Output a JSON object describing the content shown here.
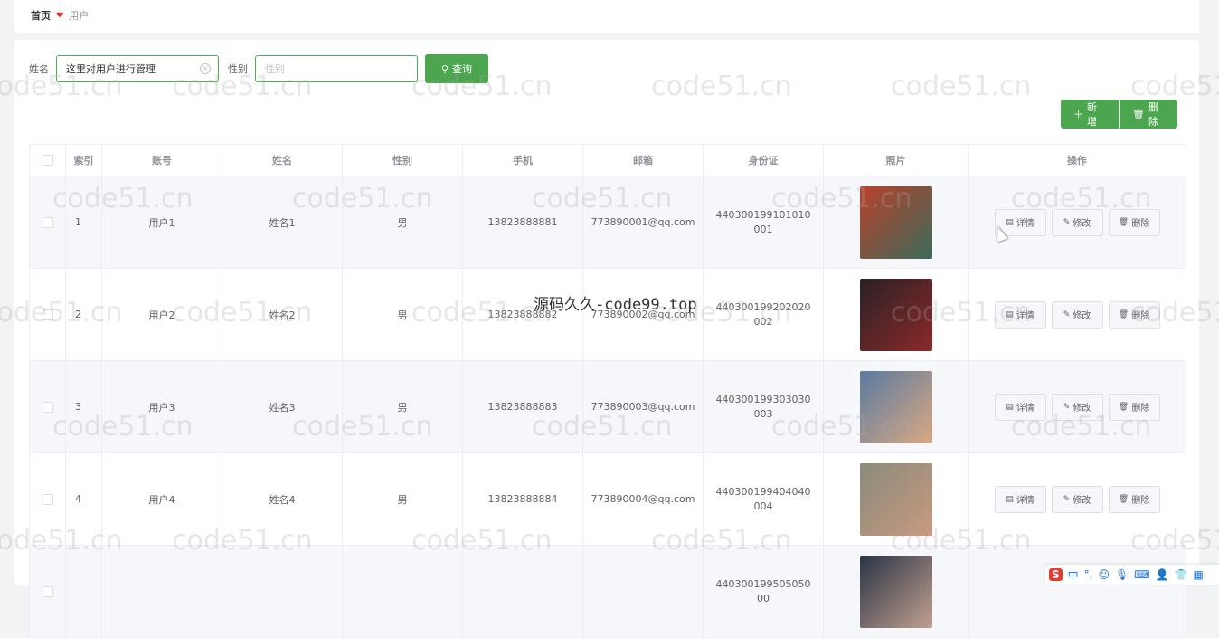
{
  "breadcrumb": {
    "home": "首页",
    "current": "用户"
  },
  "search": {
    "name_label": "姓名",
    "name_value": "这里对用户进行管理",
    "gender_label": "性别",
    "gender_placeholder": "性别",
    "query_label": "查询"
  },
  "actions": {
    "add_label": "新增",
    "delete_label": "删除"
  },
  "table": {
    "headers": [
      "索引",
      "账号",
      "姓名",
      "性别",
      "手机",
      "邮箱",
      "身份证",
      "照片",
      "操作"
    ],
    "rows": [
      {
        "index": "1",
        "account": "用户1",
        "name": "姓名1",
        "gender": "男",
        "phone": "13823888881",
        "email": "773890001@qq.com",
        "idcard": "440300199101010001"
      },
      {
        "index": "2",
        "account": "用户2",
        "name": "姓名2",
        "gender": "男",
        "phone": "13823888882",
        "email": "773890002@qq.com",
        "idcard": "440300199202020002"
      },
      {
        "index": "3",
        "account": "用户3",
        "name": "姓名3",
        "gender": "男",
        "phone": "13823888883",
        "email": "773890003@qq.com",
        "idcard": "440300199303030003"
      },
      {
        "index": "4",
        "account": "用户4",
        "name": "姓名4",
        "gender": "男",
        "phone": "13823888884",
        "email": "773890004@qq.com",
        "idcard": "440300199404040004"
      },
      {
        "index": "",
        "account": "",
        "name": "",
        "gender": "",
        "phone": "",
        "email": "",
        "idcard": "44030019950505000"
      }
    ],
    "op_labels": {
      "detail": "详情",
      "edit": "修改",
      "delete": "删除"
    }
  },
  "watermark": {
    "text": "code51.cn",
    "center_text": "源码久久-code99.top"
  },
  "ime": {
    "logo": "S",
    "mode": "中"
  },
  "colors": {
    "primary": "#4ca64f",
    "border": "#ebeef5",
    "stripe": "#f5f7fa"
  }
}
